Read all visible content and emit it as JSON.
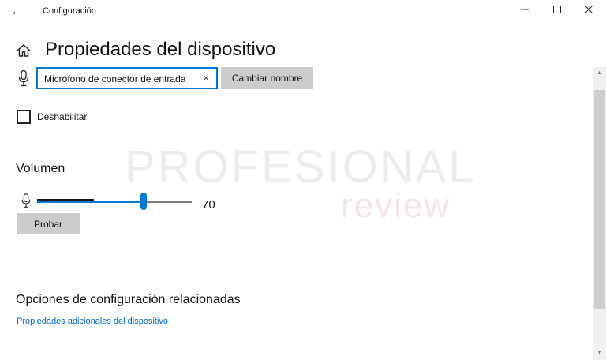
{
  "window": {
    "title": "Configuración",
    "back_glyph": "←",
    "minimize_glyph": "—",
    "maximize_glyph": "☐",
    "close_glyph": "✕"
  },
  "header": {
    "title": "Propiedades del dispositivo",
    "home_icon": "home-icon"
  },
  "device_name": {
    "value": "Micrófono de conector de entrada",
    "clear_glyph": "×",
    "rename_label": "Cambiar nombre",
    "icon": "microphone-icon"
  },
  "disable": {
    "label": "Deshabilitar",
    "checked": false
  },
  "watermark": {
    "line1": "PROFESIONAL",
    "line2": "review"
  },
  "volume": {
    "heading": "Volumen",
    "value": "70",
    "level_percent": 70,
    "test_label": "Probar",
    "icon": "microphone-icon"
  },
  "related": {
    "heading": "Opciones de configuración relacionadas",
    "link": "Propiedades adicionales del dispositivo"
  },
  "colors": {
    "accent": "#0078d4",
    "link": "#0067c0",
    "button_bg": "#cccccc"
  }
}
